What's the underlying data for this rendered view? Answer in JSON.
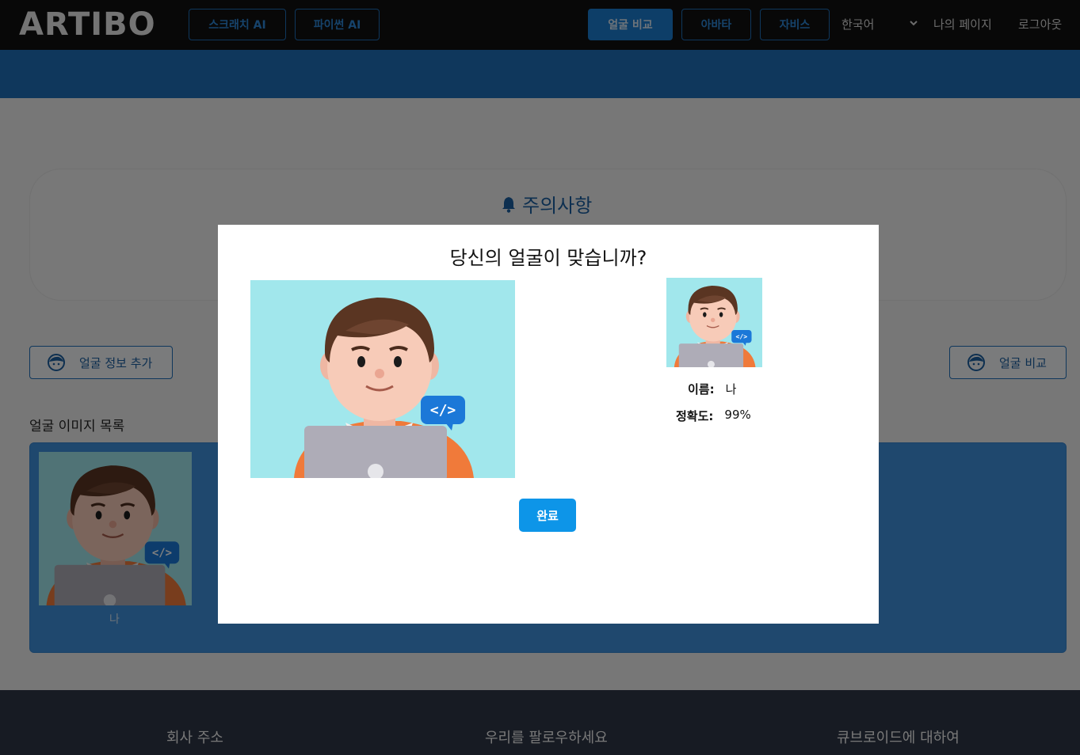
{
  "nav": {
    "logo": "ARTIBO",
    "scratch_ai": "스크래치 AI",
    "python_ai": "파이썬 AI",
    "face_compare": "얼굴 비교",
    "avatar": "아바타",
    "jarvis": "자비스",
    "language": "한국어",
    "my_page": "나의 페이지",
    "logout": "로그아웃"
  },
  "notice": {
    "title": "주의사항"
  },
  "actions": {
    "add_face_info": "얼굴 정보 추가",
    "face_compare": "얼굴 비교"
  },
  "face_list": {
    "title": "얼굴 이미지 목록",
    "items": [
      {
        "label": "나"
      }
    ]
  },
  "footer": {
    "company_address": "회사 주소",
    "follow_us": "우리를 팔로우하세요",
    "about": "큐브로이드에 대하여"
  },
  "modal": {
    "title": "당신의 얼굴이 맞습니까?",
    "name_label": "이름:",
    "name_value": "나",
    "accuracy_label": "정확도:",
    "accuracy_value": "99%",
    "done_button": "완료"
  },
  "colors": {
    "primary": "#1b7dd0",
    "nav_bg": "#101010",
    "list_bg": "#3f91dc",
    "footer_bg": "#2f3646",
    "avatar_bg": "#a3e6ec"
  }
}
